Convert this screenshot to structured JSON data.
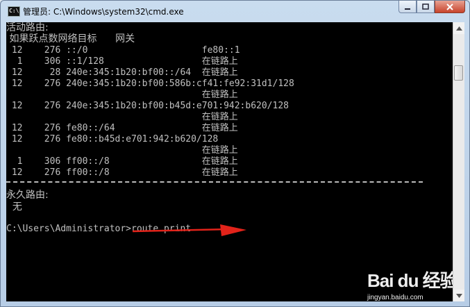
{
  "window": {
    "title": "管理员: C:\\Windows\\system32\\cmd.exe",
    "icon_text": "C:\\"
  },
  "controls": {
    "minimize": "minimize-icon",
    "maximize": "maximize-icon",
    "close": "close-icon"
  },
  "console": {
    "lines": [
      "活动路由:",
      " 如果跃点数网络目标      网关",
      " 12    276 ::/0                     fe80::1",
      "  1    306 ::1/128                  在链路上",
      " 12     28 240e:345:1b20:bf00::/64  在链路上",
      " 12    276 240e:345:1b20:bf00:586b:cf41:fe92:31d1/128",
      "                                    在链路上",
      " 12    276 240e:345:1b20:bf00:b45d:e701:942:b620/128",
      "                                    在链路上",
      " 12    276 fe80::/64                在链路上",
      " 12    276 fe80::b45d:e701:942:b620/128",
      "                                    在链路上",
      "  1    306 ff00::/8                 在链路上",
      " 12    276 ff00::/8                 在链路上",
      "永久路由:",
      "  无",
      "C:\\Users\\Administrator>route print"
    ]
  },
  "watermark": {
    "logo": "Bai du 经验",
    "url": "jingyan.baidu.com"
  }
}
